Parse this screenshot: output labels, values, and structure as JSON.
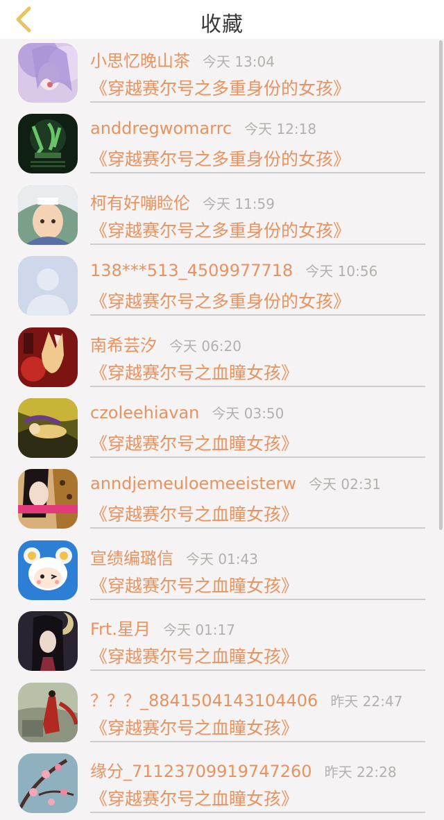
{
  "header": {
    "title": "收藏",
    "back_icon": "chevron-left-icon",
    "back_color": "#e6c45f"
  },
  "colors": {
    "accent": "#e8935f",
    "muted": "#b3b0ae",
    "background": "#f5f3f3"
  },
  "items": [
    {
      "name": "小思忆晚山茶",
      "time": "今天 13:04",
      "book": "《穿越赛尔号之多重身份的女孩》",
      "avatar": "anime-girl-purple-hair"
    },
    {
      "name": "anddregwomarrc",
      "time": "今天 12:18",
      "book": "《穿越赛尔号之多重身份的女孩》",
      "avatar": "dark-green-text-logo"
    },
    {
      "name": "柯有好嘣睑伦",
      "time": "今天 11:59",
      "book": "《穿越赛尔号之多重身份的女孩》",
      "avatar": "anime-boy-silver-hair"
    },
    {
      "name": "138***513_4509977718",
      "time": "今天 10:56",
      "book": "《穿越赛尔号之多重身份的女孩》",
      "avatar": "default-user-silhouette"
    },
    {
      "name": "南希芸汐",
      "time": "今天 06:20",
      "book": "《穿越赛尔号之血瞳女孩》",
      "avatar": "fox-girl-red"
    },
    {
      "name": "czoleehiavan",
      "time": "今天 03:50",
      "book": "《穿越赛尔号之血瞳女孩》",
      "avatar": "anime-girl-lying-yellow"
    },
    {
      "name": "anndjemeuloemeeisterw",
      "time": "今天 02:31",
      "book": "《穿越赛尔号之血瞳女孩》",
      "avatar": "girl-selfie-leopard"
    },
    {
      "name": "宣绩编璐信",
      "time": "今天 01:43",
      "book": "《穿越赛尔号之血瞳女孩》",
      "avatar": "cartoon-sheep-blue"
    },
    {
      "name": "Frt.星月",
      "time": "今天 01:17",
      "book": "《穿越赛尔号之血瞳女孩》",
      "avatar": "anime-girl-moon-dark"
    },
    {
      "name": "？？？_8841504143104406",
      "time": "昨天 22:47",
      "book": "《穿越赛尔号之血瞳女孩》",
      "avatar": "red-robed-figure-ruins"
    },
    {
      "name": "缘分_7112370991974726​0",
      "time": "昨天 22:28",
      "book": "《穿越赛尔号之血瞳女孩》",
      "avatar": "plum-blossom-branch"
    }
  ]
}
